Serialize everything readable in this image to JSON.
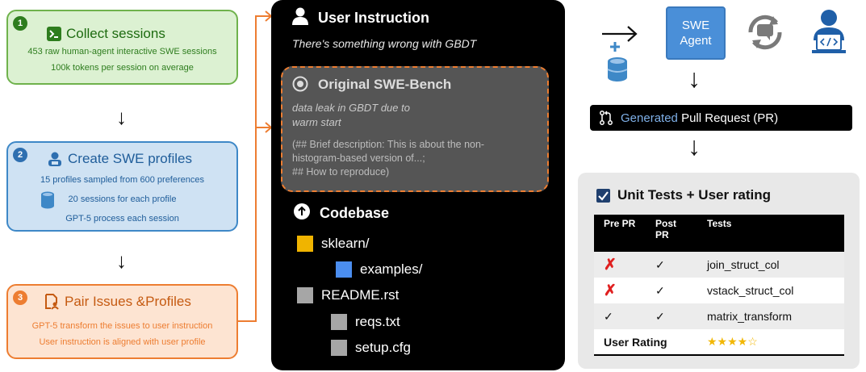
{
  "left": {
    "step1": {
      "number": "1",
      "title": "Collect sessions",
      "lines": [
        "453 raw human-agent interactive SWE sessions",
        "100k tokens per session on average"
      ]
    },
    "step2": {
      "number": "2",
      "title": "Create SWE profiles",
      "lines": [
        "15 profiles sampled from 600 preferences",
        "20 sessions for each profile",
        "GPT-5 process each session"
      ]
    },
    "step3": {
      "number": "3",
      "title": "Pair Issues &Profiles",
      "lines": [
        "GPT-5 transform the issues to user instruction",
        "User instruction is aligned with user profile"
      ]
    }
  },
  "center": {
    "user_instruction_title": "User Instruction",
    "user_instruction_text": "There's something wrong with GBDT",
    "swe_bench_title": "Original SWE-Bench",
    "swe_bench_issue": [
      "data leak in GBDT due to",
      "warm start"
    ],
    "swe_bench_desc": [
      "(## Brief description: This is about the non-",
      "histogram-based version of...;",
      "## How to reproduce)"
    ],
    "codebase_title": "Codebase",
    "files": [
      {
        "name": "sklearn/",
        "color": "#f0b400"
      },
      {
        "name": "examples/",
        "color": "#4b8ef0"
      },
      {
        "name": "README.rst",
        "color": "#a6a6a6"
      },
      {
        "name": "reqs.txt",
        "color": "#a6a6a6"
      },
      {
        "name": "setup.cfg",
        "color": "#a6a6a6"
      }
    ]
  },
  "right": {
    "agent_label": "SWE Agent",
    "pr_word1": "Generated",
    "pr_word2": "Pull Request (PR)",
    "tests_title": "Unit Tests + User rating",
    "headers": {
      "pre": "Pre PR",
      "post": "Post PR",
      "tests": "Tests"
    },
    "rows": [
      {
        "pre": "✗",
        "pre_fail": true,
        "post": "✓",
        "test": "join_struct_col"
      },
      {
        "pre": "✗",
        "pre_fail": true,
        "post": "✓",
        "test": "vstack_struct_col"
      },
      {
        "pre": "✓",
        "pre_fail": false,
        "post": "✓",
        "test": "matrix_transform"
      }
    ],
    "rating_label": "User Rating",
    "rating_stars": "★★★★☆",
    "colors": {
      "agent": "#4a8fd8",
      "star": "#f2b705",
      "generated": "#7fb0e8"
    }
  }
}
